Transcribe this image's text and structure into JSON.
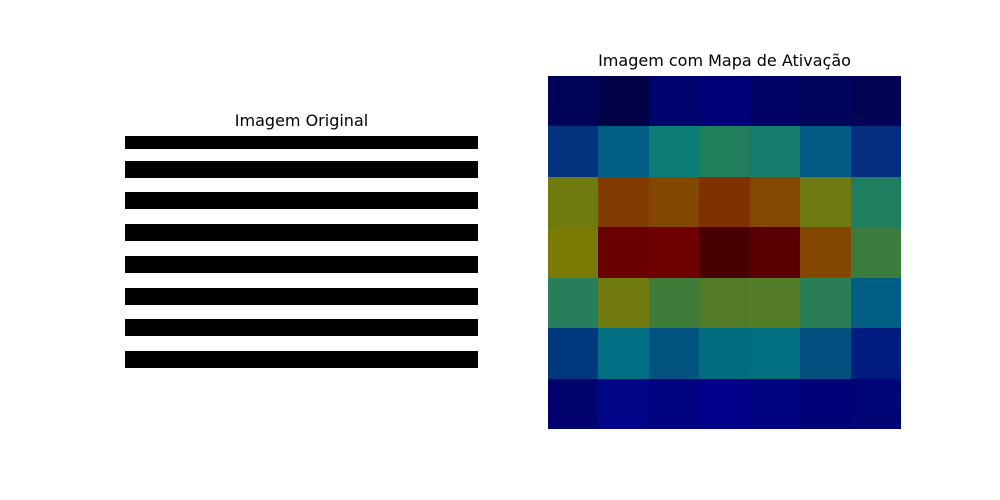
{
  "figure": {
    "left_title": "Imagem Original",
    "right_title": "Imagem com Mapa de Ativação"
  },
  "original_image": {
    "background_color": "#ffffff",
    "stripe_color": "#000000",
    "stripe_count": 8
  },
  "activation_map": {
    "rows": 7,
    "cols": 7,
    "colors": [
      [
        "#000459",
        "#000245",
        "#00046e",
        "#00007a",
        "#000268",
        "#00045b",
        "#000452"
      ],
      [
        "#02337f",
        "#015d84",
        "#0c7c76",
        "#217e5a",
        "#177d6f",
        "#015a83",
        "#032d7e"
      ],
      [
        "#6f7a0f",
        "#823b00",
        "#834800",
        "#803100",
        "#844800",
        "#6f7a13",
        "#1e7e60"
      ],
      [
        "#7a7b03",
        "#6a0101",
        "#6f0000",
        "#490000",
        "#590000",
        "#844700",
        "#3c7c3d"
      ],
      [
        "#267e5a",
        "#717a0f",
        "#3f7c3a",
        "#547c28",
        "#537d26",
        "#2a7d56",
        "#005e84"
      ],
      [
        "#00387e",
        "#006e83",
        "#01547f",
        "#006c7f",
        "#007080",
        "#014f7f",
        "#011c7f"
      ],
      [
        "#00046c",
        "#000687",
        "#00047f",
        "#00008a",
        "#000480",
        "#000375",
        "#000575"
      ]
    ]
  }
}
